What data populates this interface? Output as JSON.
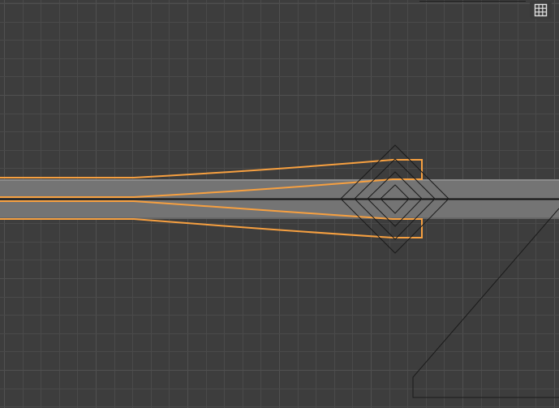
{
  "editor": {
    "type": "2d-viewport",
    "background_color": "#3d3d3d",
    "grid": {
      "visible": true,
      "line_color": "#4a4a4a",
      "line_color_major": "#505050"
    },
    "selection_color": "#f7a040",
    "center_line_color": "#111111"
  },
  "toolbar": {
    "grid_toggle": {
      "icon": "grid-icon",
      "active": false
    }
  },
  "gizmo": {
    "icon": "diamond-transform-gizmo",
    "rings": 4
  }
}
